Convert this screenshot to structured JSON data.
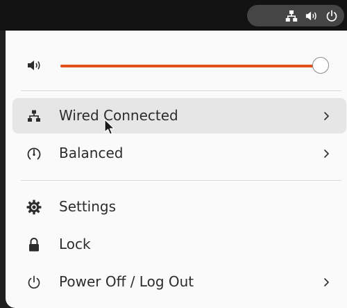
{
  "tray": {
    "icons": [
      "network-wired-icon",
      "volume-icon",
      "power-icon"
    ]
  },
  "volume": {
    "level_percent": 100,
    "accent_color": "#e2511a"
  },
  "menu_items": [
    {
      "label": "Wired Connected",
      "icon": "network-wired-icon",
      "has_submenu": true,
      "hovered": true
    },
    {
      "label": "Balanced",
      "icon": "power-profile-icon",
      "has_submenu": true
    },
    {
      "label": "Settings",
      "icon": "gear-icon",
      "has_submenu": false
    },
    {
      "label": "Lock",
      "icon": "lock-icon",
      "has_submenu": false
    },
    {
      "label": "Power Off / Log Out",
      "icon": "power-icon",
      "has_submenu": true
    }
  ]
}
